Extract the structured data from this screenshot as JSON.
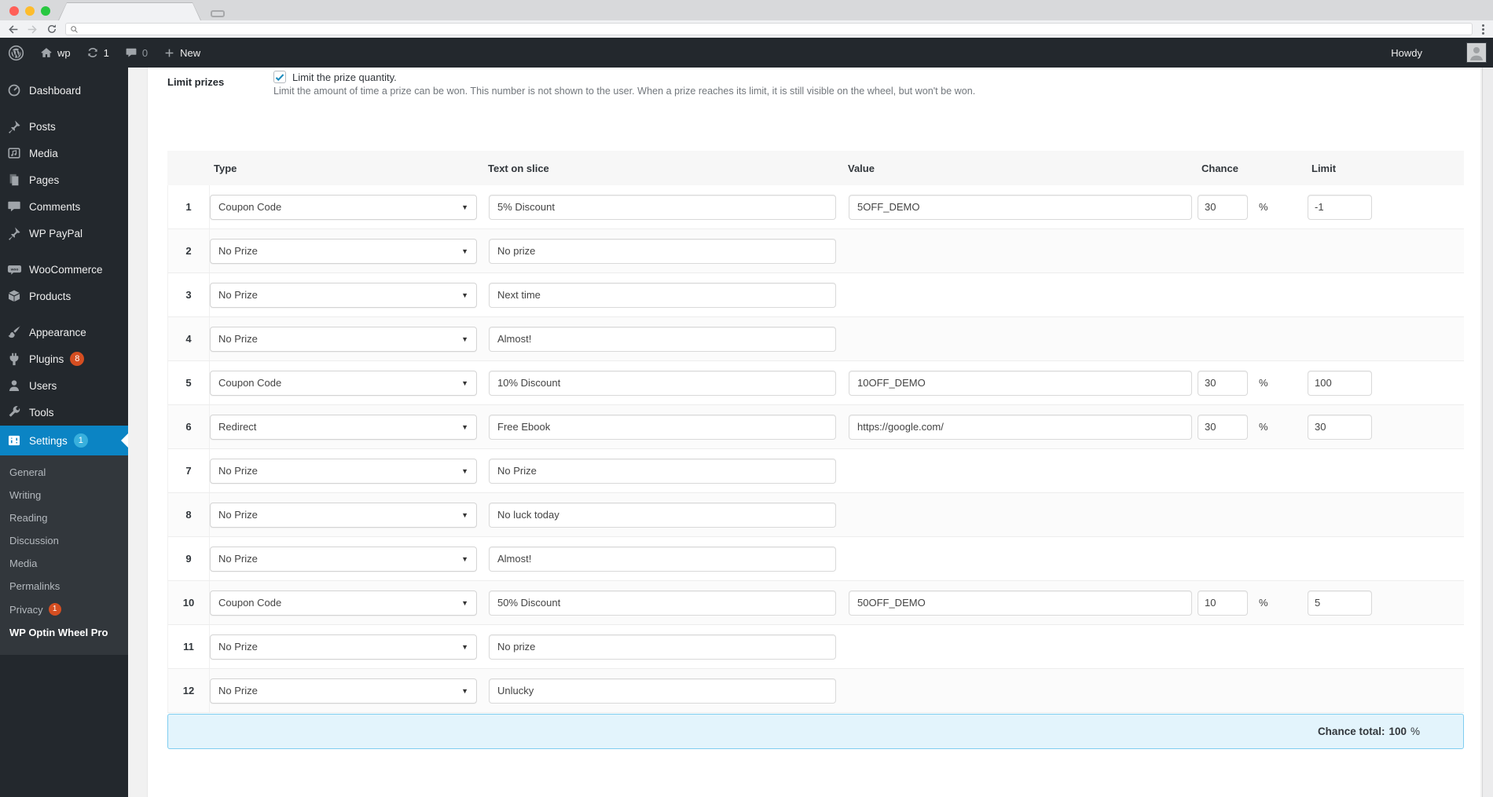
{
  "browser": {
    "url": "",
    "tab_title": ""
  },
  "admin_bar": {
    "site_name": "wp",
    "update_count": "1",
    "comment_count": "0",
    "new_label": "New",
    "howdy": "Howdy"
  },
  "sidebar": {
    "items": [
      {
        "id": "dashboard",
        "label": "Dashboard",
        "icon": "dashboard-icon"
      },
      {
        "id": "posts",
        "label": "Posts",
        "icon": "pin-icon",
        "gap": true
      },
      {
        "id": "media",
        "label": "Media",
        "icon": "media-icon"
      },
      {
        "id": "pages",
        "label": "Pages",
        "icon": "pages-icon"
      },
      {
        "id": "comments",
        "label": "Comments",
        "icon": "comment-icon"
      },
      {
        "id": "wp-paypal",
        "label": "WP PayPal",
        "icon": "pin-icon"
      },
      {
        "id": "woocommerce",
        "label": "WooCommerce",
        "icon": "woocommerce-icon",
        "gap": true
      },
      {
        "id": "products",
        "label": "Products",
        "icon": "box-icon"
      },
      {
        "id": "appearance",
        "label": "Appearance",
        "icon": "brush-icon",
        "gap": true
      },
      {
        "id": "plugins",
        "label": "Plugins",
        "icon": "plugin-icon",
        "badge": "8",
        "badge_color": "red"
      },
      {
        "id": "users",
        "label": "Users",
        "icon": "user-icon"
      },
      {
        "id": "tools",
        "label": "Tools",
        "icon": "wrench-icon"
      },
      {
        "id": "settings",
        "label": "Settings",
        "icon": "settings-icon",
        "badge": "1",
        "badge_color": "blue",
        "current": true
      }
    ],
    "submenu": [
      {
        "id": "general",
        "label": "General"
      },
      {
        "id": "writing",
        "label": "Writing"
      },
      {
        "id": "reading",
        "label": "Reading"
      },
      {
        "id": "discussion",
        "label": "Discussion"
      },
      {
        "id": "media-settings",
        "label": "Media"
      },
      {
        "id": "permalinks",
        "label": "Permalinks"
      },
      {
        "id": "privacy",
        "label": "Privacy",
        "badge": "1",
        "badge_color": "red"
      },
      {
        "id": "wp-optin-wheel-pro",
        "label": "WP Optin Wheel Pro",
        "current": true
      }
    ]
  },
  "section": {
    "label": "Limit prizes",
    "checkbox_checked": true,
    "checkbox_label": "Limit the prize quantity.",
    "description": "Limit the amount of time a prize can be won. This number is not shown to the user. When a prize reaches its limit, it is still visible on the wheel, but won't be won."
  },
  "table": {
    "headers": {
      "type": "Type",
      "text": "Text on slice",
      "value": "Value",
      "chance": "Chance",
      "limit": "Limit"
    },
    "percent_sign": "%",
    "rows": [
      {
        "n": "1",
        "type": "Coupon Code",
        "text": "5% Discount",
        "value": "5OFF_DEMO",
        "chance": "30",
        "limit": "-1"
      },
      {
        "n": "2",
        "type": "No Prize",
        "text": "No prize"
      },
      {
        "n": "3",
        "type": "No Prize",
        "text": "Next time"
      },
      {
        "n": "4",
        "type": "No Prize",
        "text": "Almost!"
      },
      {
        "n": "5",
        "type": "Coupon Code",
        "text": "10% Discount",
        "value": "10OFF_DEMO",
        "chance": "30",
        "limit": "100"
      },
      {
        "n": "6",
        "type": "Redirect",
        "text": "Free Ebook",
        "value": "https://google.com/",
        "chance": "30",
        "limit": "30"
      },
      {
        "n": "7",
        "type": "No Prize",
        "text": "No Prize"
      },
      {
        "n": "8",
        "type": "No Prize",
        "text": "No luck today"
      },
      {
        "n": "9",
        "type": "No Prize",
        "text": "Almost!"
      },
      {
        "n": "10",
        "type": "Coupon Code",
        "text": "50% Discount",
        "value": "50OFF_DEMO",
        "chance": "10",
        "limit": "5"
      },
      {
        "n": "11",
        "type": "No Prize",
        "text": "No prize"
      },
      {
        "n": "12",
        "type": "No Prize",
        "text": "Unlucky"
      }
    ]
  },
  "total": {
    "label": "Chance total:",
    "value": "100",
    "unit": "%"
  },
  "colors": {
    "accent_blue": "#0b84c4",
    "badge_red": "#d54e21",
    "badge_blue": "#38b0dd",
    "check_blue": "#1e8cbe",
    "total_bg": "#e3f4fc",
    "total_border": "#7fcdf0"
  }
}
